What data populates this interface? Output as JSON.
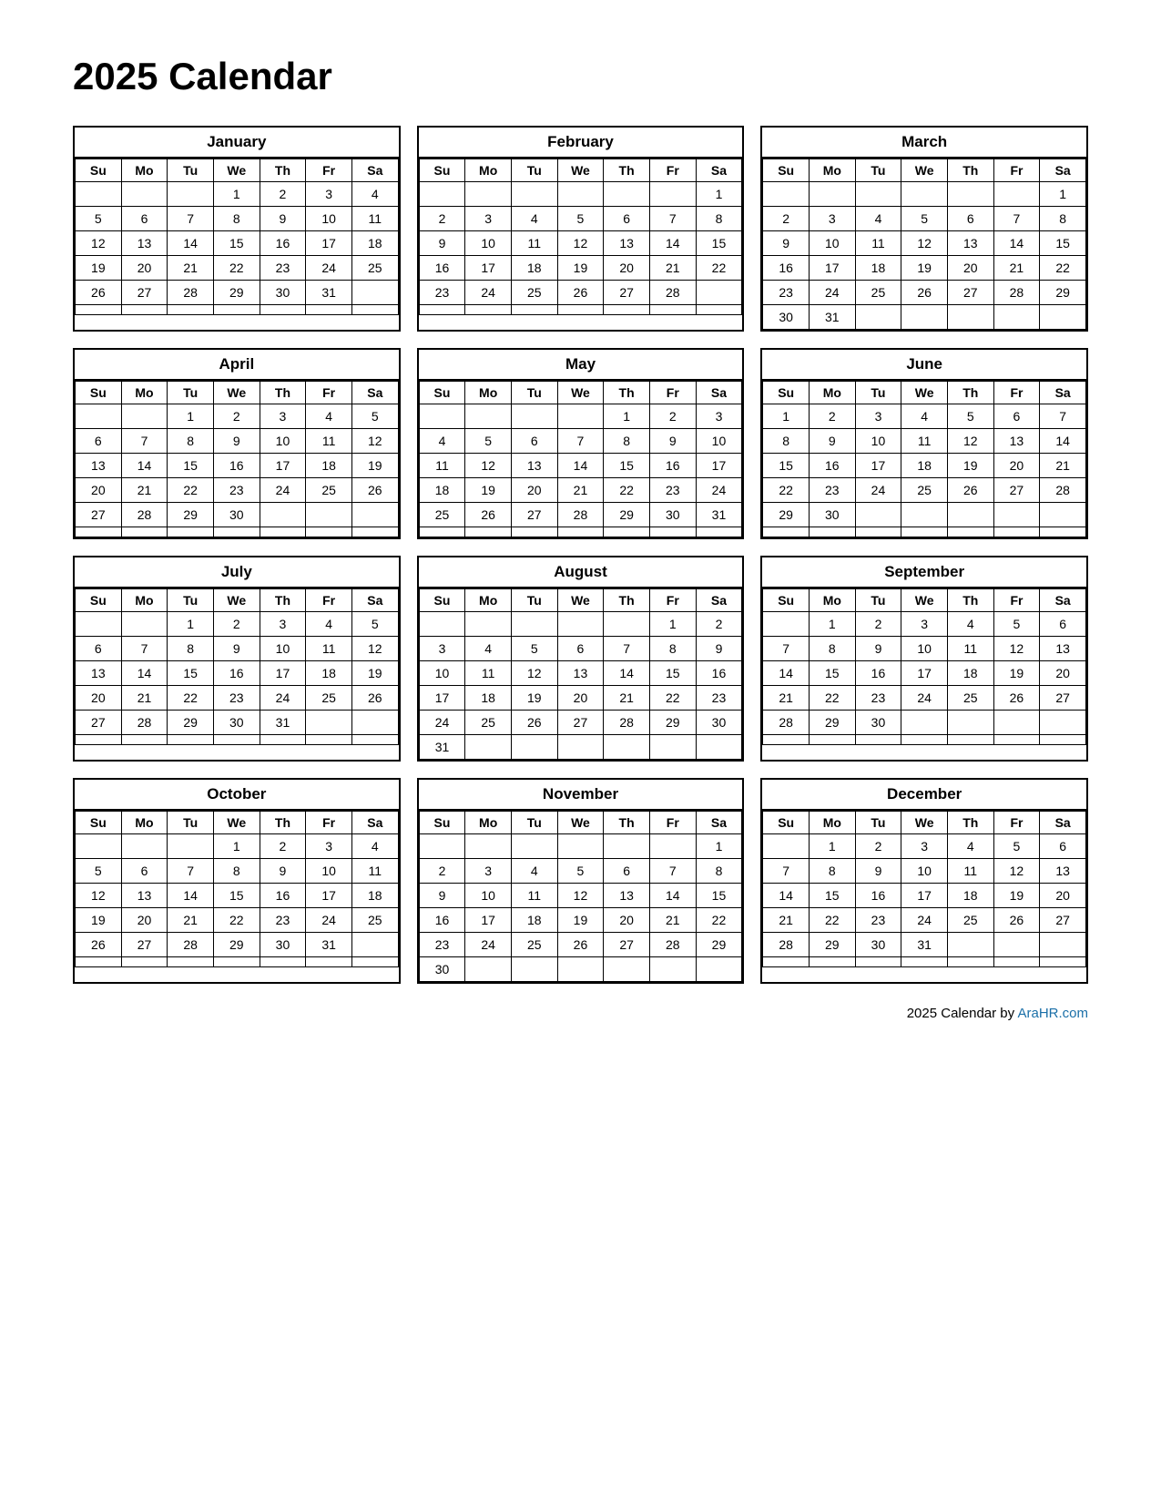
{
  "title": "2025 Calendar",
  "footer": {
    "text": "2025  Calendar by ",
    "link_label": "AraHR.com",
    "link_url": "https://AraHR.com"
  },
  "months": [
    {
      "name": "January",
      "days_header": [
        "Su",
        "Mo",
        "Tu",
        "We",
        "Th",
        "Fr",
        "Sa"
      ],
      "weeks": [
        [
          "",
          "",
          "",
          "1",
          "2",
          "3",
          "4"
        ],
        [
          "5",
          "6",
          "7",
          "8",
          "9",
          "10",
          "11"
        ],
        [
          "12",
          "13",
          "14",
          "15",
          "16",
          "17",
          "18"
        ],
        [
          "19",
          "20",
          "21",
          "22",
          "23",
          "24",
          "25"
        ],
        [
          "26",
          "27",
          "28",
          "29",
          "30",
          "31",
          ""
        ],
        [
          "",
          "",
          "",
          "",
          "",
          "",
          ""
        ]
      ]
    },
    {
      "name": "February",
      "days_header": [
        "Su",
        "Mo",
        "Tu",
        "We",
        "Th",
        "Fr",
        "Sa"
      ],
      "weeks": [
        [
          "",
          "",
          "",
          "",
          "",
          "",
          "1"
        ],
        [
          "2",
          "3",
          "4",
          "5",
          "6",
          "7",
          "8"
        ],
        [
          "9",
          "10",
          "11",
          "12",
          "13",
          "14",
          "15"
        ],
        [
          "16",
          "17",
          "18",
          "19",
          "20",
          "21",
          "22"
        ],
        [
          "23",
          "24",
          "25",
          "26",
          "27",
          "28",
          ""
        ],
        [
          "",
          "",
          "",
          "",
          "",
          "",
          ""
        ]
      ]
    },
    {
      "name": "March",
      "days_header": [
        "Su",
        "Mo",
        "Tu",
        "We",
        "Th",
        "Fr",
        "Sa"
      ],
      "weeks": [
        [
          "",
          "",
          "",
          "",
          "",
          "",
          "1"
        ],
        [
          "2",
          "3",
          "4",
          "5",
          "6",
          "7",
          "8"
        ],
        [
          "9",
          "10",
          "11",
          "12",
          "13",
          "14",
          "15"
        ],
        [
          "16",
          "17",
          "18",
          "19",
          "20",
          "21",
          "22"
        ],
        [
          "23",
          "24",
          "25",
          "26",
          "27",
          "28",
          "29"
        ],
        [
          "30",
          "31",
          "",
          "",
          "",
          "",
          ""
        ]
      ]
    },
    {
      "name": "April",
      "days_header": [
        "Su",
        "Mo",
        "Tu",
        "We",
        "Th",
        "Fr",
        "Sa"
      ],
      "weeks": [
        [
          "",
          "",
          "1",
          "2",
          "3",
          "4",
          "5"
        ],
        [
          "6",
          "7",
          "8",
          "9",
          "10",
          "11",
          "12"
        ],
        [
          "13",
          "14",
          "15",
          "16",
          "17",
          "18",
          "19"
        ],
        [
          "20",
          "21",
          "22",
          "23",
          "24",
          "25",
          "26"
        ],
        [
          "27",
          "28",
          "29",
          "30",
          "",
          "",
          ""
        ],
        [
          "",
          "",
          "",
          "",
          "",
          "",
          ""
        ]
      ]
    },
    {
      "name": "May",
      "days_header": [
        "Su",
        "Mo",
        "Tu",
        "We",
        "Th",
        "Fr",
        "Sa"
      ],
      "weeks": [
        [
          "",
          "",
          "",
          "",
          "1",
          "2",
          "3"
        ],
        [
          "4",
          "5",
          "6",
          "7",
          "8",
          "9",
          "10"
        ],
        [
          "11",
          "12",
          "13",
          "14",
          "15",
          "16",
          "17"
        ],
        [
          "18",
          "19",
          "20",
          "21",
          "22",
          "23",
          "24"
        ],
        [
          "25",
          "26",
          "27",
          "28",
          "29",
          "30",
          "31"
        ],
        [
          "",
          "",
          "",
          "",
          "",
          "",
          ""
        ]
      ]
    },
    {
      "name": "June",
      "days_header": [
        "Su",
        "Mo",
        "Tu",
        "We",
        "Th",
        "Fr",
        "Sa"
      ],
      "weeks": [
        [
          "1",
          "2",
          "3",
          "4",
          "5",
          "6",
          "7"
        ],
        [
          "8",
          "9",
          "10",
          "11",
          "12",
          "13",
          "14"
        ],
        [
          "15",
          "16",
          "17",
          "18",
          "19",
          "20",
          "21"
        ],
        [
          "22",
          "23",
          "24",
          "25",
          "26",
          "27",
          "28"
        ],
        [
          "29",
          "30",
          "",
          "",
          "",
          "",
          ""
        ],
        [
          "",
          "",
          "",
          "",
          "",
          "",
          ""
        ]
      ]
    },
    {
      "name": "July",
      "days_header": [
        "Su",
        "Mo",
        "Tu",
        "We",
        "Th",
        "Fr",
        "Sa"
      ],
      "weeks": [
        [
          "",
          "",
          "1",
          "2",
          "3",
          "4",
          "5"
        ],
        [
          "6",
          "7",
          "8",
          "9",
          "10",
          "11",
          "12"
        ],
        [
          "13",
          "14",
          "15",
          "16",
          "17",
          "18",
          "19"
        ],
        [
          "20",
          "21",
          "22",
          "23",
          "24",
          "25",
          "26"
        ],
        [
          "27",
          "28",
          "29",
          "30",
          "31",
          "",
          ""
        ],
        [
          "",
          "",
          "",
          "",
          "",
          "",
          ""
        ]
      ]
    },
    {
      "name": "August",
      "days_header": [
        "Su",
        "Mo",
        "Tu",
        "We",
        "Th",
        "Fr",
        "Sa"
      ],
      "weeks": [
        [
          "",
          "",
          "",
          "",
          "",
          "1",
          "2"
        ],
        [
          "3",
          "4",
          "5",
          "6",
          "7",
          "8",
          "9"
        ],
        [
          "10",
          "11",
          "12",
          "13",
          "14",
          "15",
          "16"
        ],
        [
          "17",
          "18",
          "19",
          "20",
          "21",
          "22",
          "23"
        ],
        [
          "24",
          "25",
          "26",
          "27",
          "28",
          "29",
          "30"
        ],
        [
          "31",
          "",
          "",
          "",
          "",
          "",
          ""
        ]
      ]
    },
    {
      "name": "September",
      "days_header": [
        "Su",
        "Mo",
        "Tu",
        "We",
        "Th",
        "Fr",
        "Sa"
      ],
      "weeks": [
        [
          "",
          "1",
          "2",
          "3",
          "4",
          "5",
          "6"
        ],
        [
          "7",
          "8",
          "9",
          "10",
          "11",
          "12",
          "13"
        ],
        [
          "14",
          "15",
          "16",
          "17",
          "18",
          "19",
          "20"
        ],
        [
          "21",
          "22",
          "23",
          "24",
          "25",
          "26",
          "27"
        ],
        [
          "28",
          "29",
          "30",
          "",
          "",
          "",
          ""
        ],
        [
          "",
          "",
          "",
          "",
          "",
          "",
          ""
        ]
      ]
    },
    {
      "name": "October",
      "days_header": [
        "Su",
        "Mo",
        "Tu",
        "We",
        "Th",
        "Fr",
        "Sa"
      ],
      "weeks": [
        [
          "",
          "",
          "",
          "1",
          "2",
          "3",
          "4"
        ],
        [
          "5",
          "6",
          "7",
          "8",
          "9",
          "10",
          "11"
        ],
        [
          "12",
          "13",
          "14",
          "15",
          "16",
          "17",
          "18"
        ],
        [
          "19",
          "20",
          "21",
          "22",
          "23",
          "24",
          "25"
        ],
        [
          "26",
          "27",
          "28",
          "29",
          "30",
          "31",
          ""
        ],
        [
          "",
          "",
          "",
          "",
          "",
          "",
          ""
        ]
      ]
    },
    {
      "name": "November",
      "days_header": [
        "Su",
        "Mo",
        "Tu",
        "We",
        "Th",
        "Fr",
        "Sa"
      ],
      "weeks": [
        [
          "",
          "",
          "",
          "",
          "",
          "",
          "1"
        ],
        [
          "2",
          "3",
          "4",
          "5",
          "6",
          "7",
          "8"
        ],
        [
          "9",
          "10",
          "11",
          "12",
          "13",
          "14",
          "15"
        ],
        [
          "16",
          "17",
          "18",
          "19",
          "20",
          "21",
          "22"
        ],
        [
          "23",
          "24",
          "25",
          "26",
          "27",
          "28",
          "29"
        ],
        [
          "30",
          "",
          "",
          "",
          "",
          "",
          ""
        ]
      ]
    },
    {
      "name": "December",
      "days_header": [
        "Su",
        "Mo",
        "Tu",
        "We",
        "Th",
        "Fr",
        "Sa"
      ],
      "weeks": [
        [
          "",
          "1",
          "2",
          "3",
          "4",
          "5",
          "6"
        ],
        [
          "7",
          "8",
          "9",
          "10",
          "11",
          "12",
          "13"
        ],
        [
          "14",
          "15",
          "16",
          "17",
          "18",
          "19",
          "20"
        ],
        [
          "21",
          "22",
          "23",
          "24",
          "25",
          "26",
          "27"
        ],
        [
          "28",
          "29",
          "30",
          "31",
          "",
          "",
          ""
        ],
        [
          "",
          "",
          "",
          "",
          "",
          "",
          ""
        ]
      ]
    }
  ]
}
